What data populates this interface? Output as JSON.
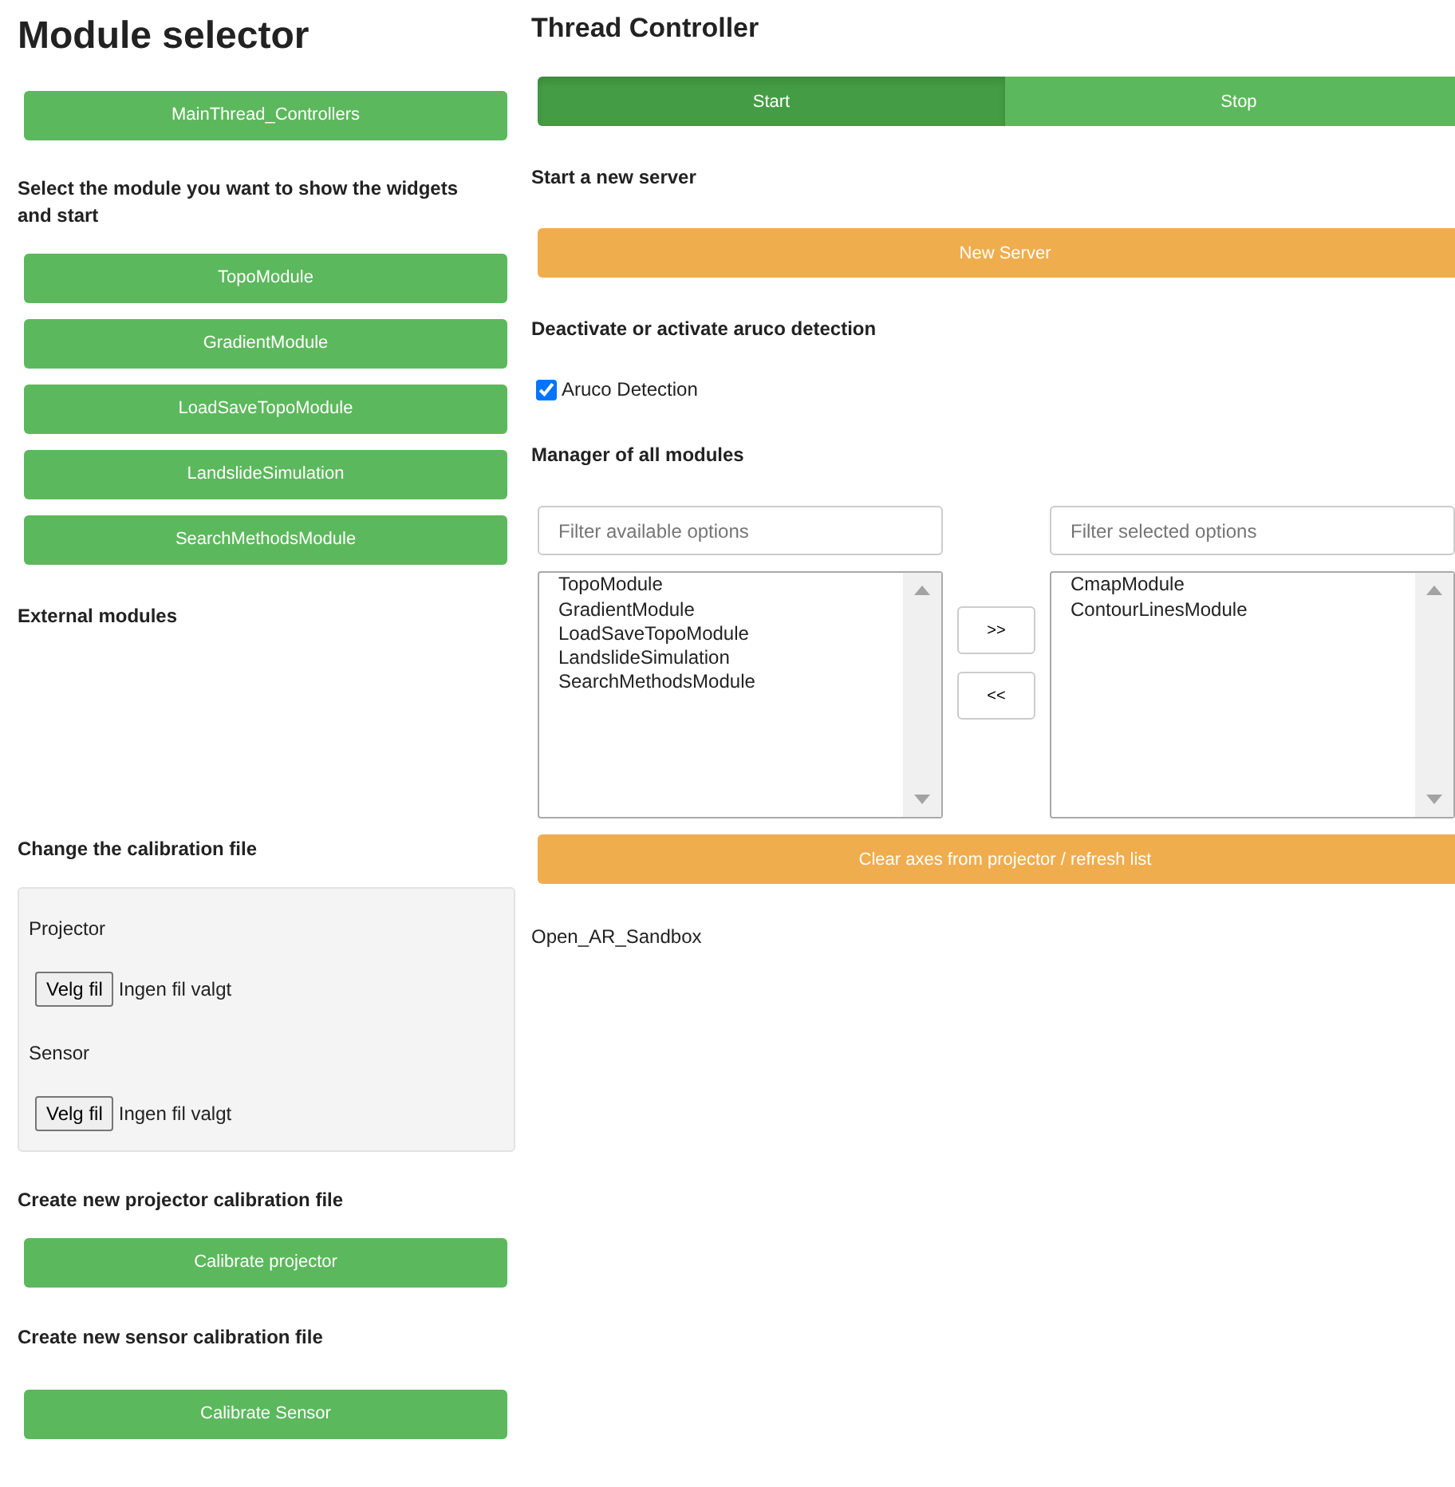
{
  "left": {
    "title": "Module selector",
    "main_button": "MainThread_Controllers",
    "select_label": "Select the module you want to show the widgets and start",
    "modules": [
      "TopoModule",
      "GradientModule",
      "LoadSaveTopoModule",
      "LandslideSimulation",
      "SearchMethodsModule"
    ],
    "external_label": "External modules",
    "calibration_label": "Change the calibration file",
    "calibration_files": [
      {
        "label": "Projector",
        "button": "Velg fil",
        "status": "Ingen fil valgt"
      },
      {
        "label": "Sensor",
        "button": "Velg fil",
        "status": "Ingen fil valgt"
      }
    ],
    "projector_label": "Create new projector calibration file",
    "projector_button": "Calibrate projector",
    "sensor_label": "Create new sensor calibration file",
    "sensor_button": "Calibrate Sensor"
  },
  "right": {
    "title": "Thread Controller",
    "toggle": [
      {
        "label": "Start",
        "selected": true
      },
      {
        "label": "Stop",
        "selected": false
      }
    ],
    "server_label": "Start a new server",
    "server_button": "New Server",
    "aruco_label": "Deactivate or activate aruco detection",
    "aruco_checkbox": {
      "label": "Aruco Detection",
      "checked": true
    },
    "manager_label": "Manager of all modules",
    "available": {
      "placeholder": "Filter available options",
      "items": [
        "TopoModule",
        "GradientModule",
        "LoadSaveTopoModule",
        "LandslideSimulation",
        "SearchMethodsModule"
      ]
    },
    "selected": {
      "placeholder": "Filter selected options",
      "items": [
        "CmapModule",
        "ContourLinesModule"
      ]
    },
    "add_button": ">>",
    "remove_button": "<<",
    "clear_button": "Clear axes from projector / refresh list",
    "footer": "Open_AR_Sandbox"
  }
}
